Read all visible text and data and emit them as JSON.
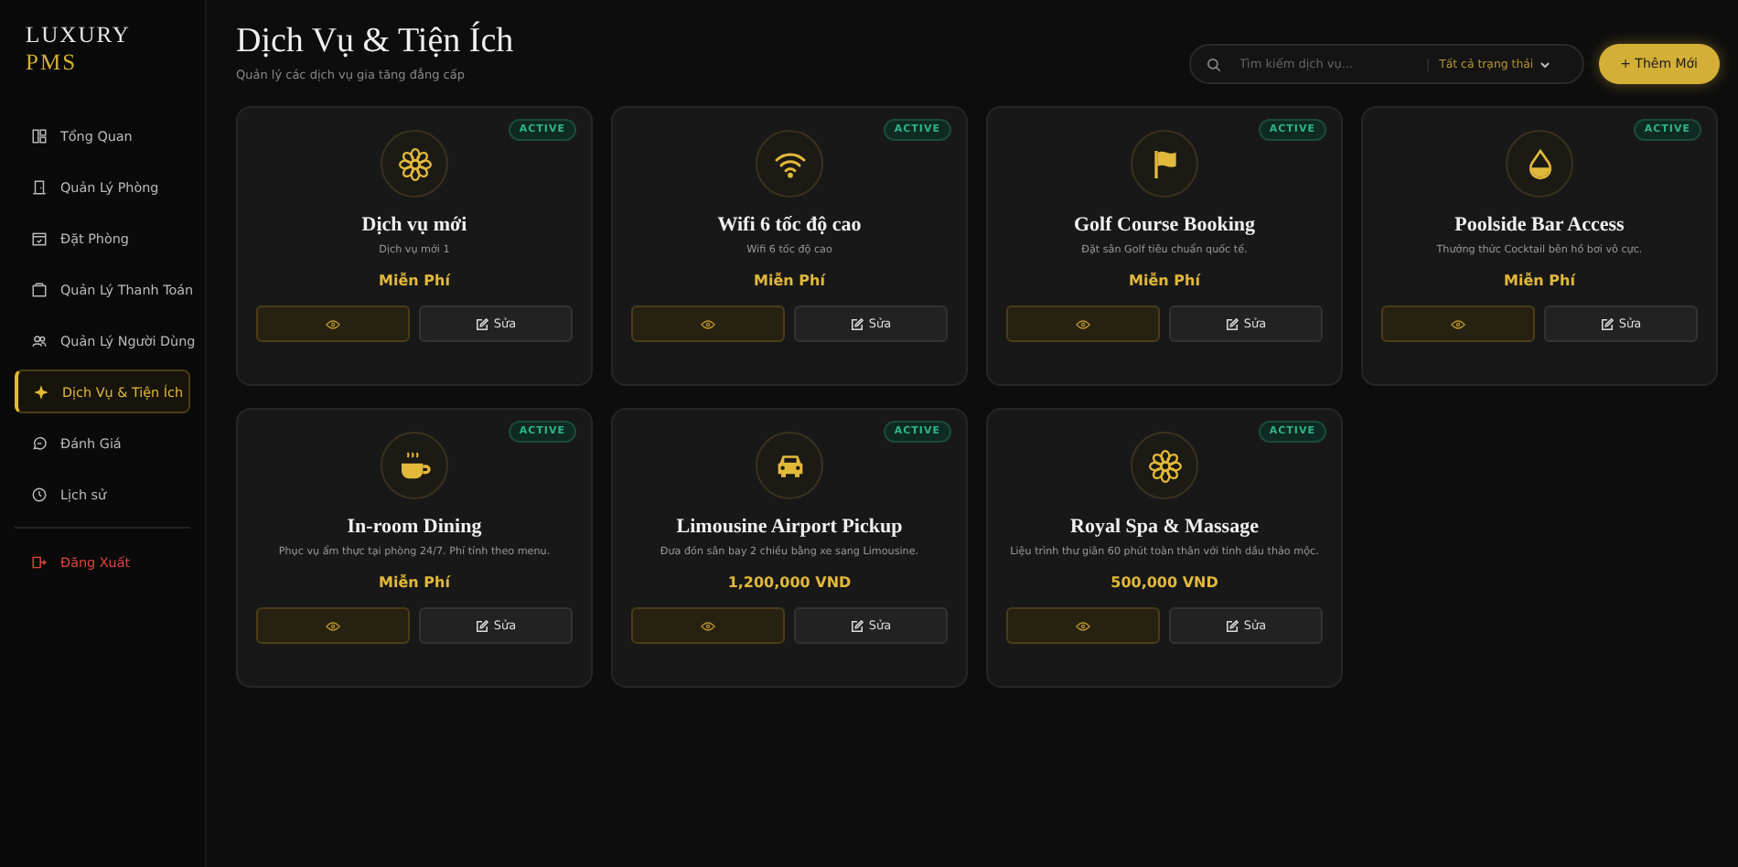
{
  "brand": {
    "name": "LUXURY",
    "accent": "PMS"
  },
  "nav": [
    {
      "label": "Tổng Quan",
      "kind": "dashboard",
      "selected": false
    },
    {
      "label": "Quản Lý Phòng",
      "kind": "door",
      "selected": false
    },
    {
      "label": "Đặt Phòng",
      "kind": "calendar",
      "selected": false
    },
    {
      "label": "Quản Lý Thanh Toán",
      "kind": "wallet",
      "selected": false
    },
    {
      "label": "Quản Lý Người Dùng",
      "kind": "users",
      "selected": false
    },
    {
      "label": "Dịch Vụ & Tiện Ích",
      "kind": "sparkle",
      "selected": true
    },
    {
      "label": "Đánh Giá",
      "kind": "chat",
      "selected": false
    },
    {
      "label": "Lịch sử",
      "kind": "clock",
      "selected": false
    }
  ],
  "logout": {
    "label": "Đăng Xuất"
  },
  "page": {
    "title": "Dịch Vụ & Tiện Ích",
    "subtitle": "Quản lý các dịch vụ gia tăng đẳng cấp"
  },
  "search": {
    "placeholder": "Tìm kiếm dịch vụ..."
  },
  "filter": {
    "value": "Tất cả trạng thái"
  },
  "add_button": {
    "icon": "+",
    "label": "Thêm Mới"
  },
  "services": [
    {
      "name": "Dịch vụ mới",
      "description": "Dịch vụ mới 1",
      "price": "Miễn Phí",
      "status": "ACTIVE",
      "kind": "flower",
      "edit": "Sửa"
    },
    {
      "name": "Wifi 6 tốc độ cao",
      "description": "Wifi 6 tốc độ cao",
      "price": "Miễn Phí",
      "status": "ACTIVE",
      "kind": "wifi",
      "edit": "Sửa"
    },
    {
      "name": "Golf Course Booking",
      "description": "Đặt sân Golf tiêu chuẩn quốc tế.",
      "price": "Miễn Phí",
      "status": "ACTIVE",
      "kind": "flag",
      "edit": "Sửa"
    },
    {
      "name": "Poolside Bar Access",
      "description": "Thưởng thức Cocktail bên hồ bơi vô cực.",
      "price": "Miễn Phí",
      "status": "ACTIVE",
      "kind": "drop",
      "edit": "Sửa"
    },
    {
      "name": "In-room Dining",
      "description": "Phục vụ ẩm thực tại phòng 24/7. Phí tính theo menu.",
      "price": "Miễn Phí",
      "status": "ACTIVE",
      "kind": "cup",
      "edit": "Sửa"
    },
    {
      "name": "Limousine Airport Pickup",
      "description": "Đưa đón sân bay 2 chiều bằng xe sang Limousine.",
      "price": "1,200,000 VND",
      "status": "ACTIVE",
      "kind": "car",
      "edit": "Sửa"
    },
    {
      "name": "Royal Spa & Massage",
      "description": "Liệu trình thư giãn 60 phút toàn thân với tinh dầu thảo mộc.",
      "price": "500,000 VND",
      "status": "ACTIVE",
      "kind": "flower",
      "edit": "Sửa"
    }
  ]
}
